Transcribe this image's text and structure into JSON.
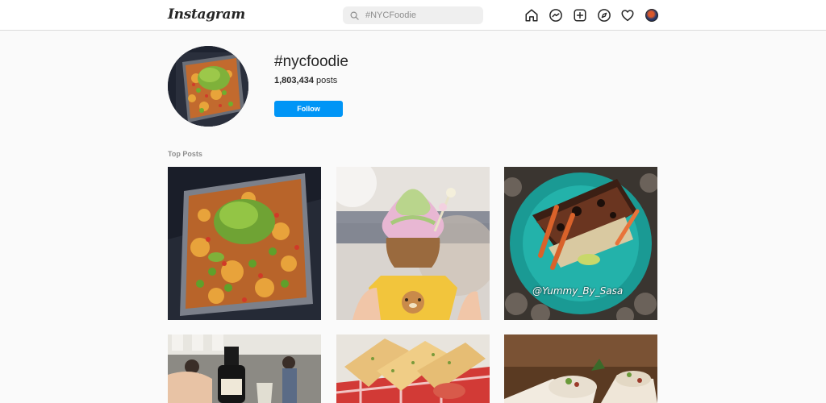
{
  "app": {
    "logo_text": "Instagram"
  },
  "search": {
    "placeholder": "#NYCFoodie"
  },
  "nav": {
    "icons": [
      "home-icon",
      "messenger-icon",
      "new-post-icon",
      "explore-icon",
      "activity-heart-icon",
      "profile-avatar"
    ]
  },
  "hashtag": {
    "title": "#nycfoodie",
    "post_count": "1,803,434",
    "post_count_suffix": "posts",
    "follow_label": "Follow"
  },
  "section": {
    "top_posts_label": "Top Posts"
  },
  "posts": [
    {
      "subject": "nachos-with-guacamole"
    },
    {
      "subject": "swirl-soft-serve-in-fish-cone"
    },
    {
      "subject": "blackened-fish-on-teal-plate",
      "watermark": "@Yummy_By_Sasa"
    },
    {
      "subject": "restaurant-wine-bottle"
    },
    {
      "subject": "garlic-bread-slices"
    },
    {
      "subject": "wrap-sandwich"
    }
  ],
  "colors": {
    "accent": "#0095f6",
    "background": "#fafafa",
    "border": "#dbdbdb"
  }
}
